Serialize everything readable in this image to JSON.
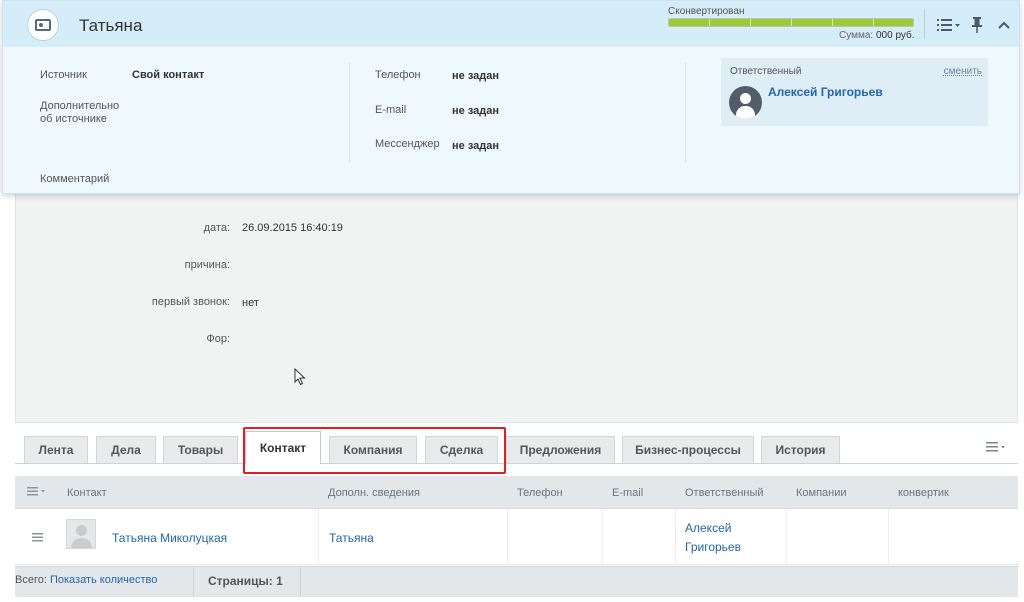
{
  "lead": {
    "title": "Татьяна",
    "conversion": {
      "label": "Сконвертирован",
      "progress": 1.0,
      "sum_label": "Сумма:",
      "sum_value": "000 руб."
    }
  },
  "summary": {
    "source_label": "Источник",
    "source_value": "Свой контакт",
    "source_info_label_1": "Дополнительно",
    "source_info_label_2": "об источнике",
    "comment_label": "Комментарий",
    "phone_label": "Телефон",
    "phone_value": "не задан",
    "email_label": "E-mail",
    "email_value": "не задан",
    "messenger_label": "Мессенджер",
    "messenger_value": "не задан",
    "responsible": {
      "label": "Ответственный",
      "change": "сменить",
      "name": "Алексей Григорьев"
    }
  },
  "details": [
    {
      "label": "дата:",
      "value": "26.09.2015 16:40:19"
    },
    {
      "label": "причина:",
      "value": ""
    },
    {
      "label": "первый звонок:",
      "value": "нет"
    },
    {
      "label": "Фор:",
      "value": ""
    }
  ],
  "tabs": [
    "Лента",
    "Дела",
    "Товары",
    "Контакт",
    "Компания",
    "Сделка",
    "Предложения",
    "Бизнес-процессы",
    "История"
  ],
  "active_tab": "Контакт",
  "grid": {
    "columns": [
      "Контакт",
      "Дополн. сведения",
      "Телефон",
      "E-mail",
      "Ответственный",
      "Компании",
      "конвертик"
    ],
    "rows": [
      {
        "contact": "Татьяна Миколуцкая",
        "extra": "Татьяна",
        "phone": "",
        "email": "",
        "responsible_1": "Алексей",
        "responsible_2": "Григорьев",
        "companies": "",
        "envelope": ""
      }
    ]
  },
  "footer": {
    "total_label": "Всего:",
    "show_count": "Показать количество",
    "pages_label": "Страницы: 1"
  },
  "colors": {
    "header_bg": "#d4edf9",
    "progress": "#9bcb3c",
    "link": "#2067b0",
    "highlight": "#e02020"
  }
}
